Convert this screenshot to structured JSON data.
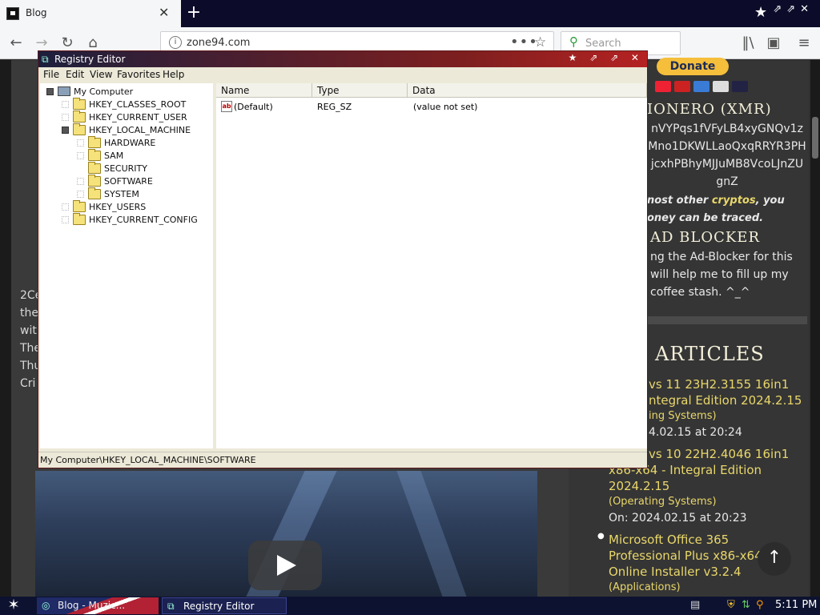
{
  "browser": {
    "tab_title": "Blog",
    "tab_close": "✕",
    "new_tab": "+",
    "url": "zone94.com",
    "search_placeholder": "Search",
    "window_controls": "⇗⇗✕"
  },
  "webpage": {
    "donate_label": "Donate",
    "monero_heading": "IONERO (XMR)",
    "monero_address_lines": [
      "nVYPqs1fVFyLB4xyGNQv1z",
      "Mno1DKWLLaoQxqRRYR3PH",
      "jcxhPBhyMJJuMB8VcoLJnZU",
      "gnZ"
    ],
    "monero_note_1_a": "nost other ",
    "monero_note_1_link": "cryptos",
    "monero_note_1_b": ", you",
    "monero_note_2": "oney can be traced.",
    "adblock_heading": "AD BLOCKER",
    "adblock_lines": [
      "ng the Ad-Blocker for this",
      "will help me to fill up my",
      "coffee stash. ^_^"
    ],
    "articles_heading": "ARTICLES",
    "article1_title_lines": [
      "vs 11 23H2.3155 16in1",
      "ntegral Edition 2024.2.15"
    ],
    "article1_category": "ing Systems)",
    "article1_date": "4.02.15 at 20:24",
    "article2_title_lines": [
      "vs 10 22H2.4046 16in1",
      "x86-x64 - Integral Edition",
      "2024.2.15"
    ],
    "article2_category": "(Operating Systems)",
    "article2_date": "On: 2024.02.15 at 20:23",
    "article3_title_lines": [
      "Microsoft Office 365",
      "Professional Plus x86-x64 -",
      "Online Installer v3.2.4"
    ],
    "article3_category": "(Applications)",
    "left_text_lines": [
      "2Ce",
      "the",
      "wit",
      "The",
      "Thu",
      "Cri"
    ],
    "totop_label": "↑"
  },
  "regedit": {
    "title": "Registry Editor",
    "window_controls": "★ ⇗ ⇗ ✕",
    "menu": [
      "File",
      "Edit",
      "View",
      "Favorites",
      "Help"
    ],
    "tree": {
      "root": "My Computer",
      "hives": [
        "HKEY_CLASSES_ROOT",
        "HKEY_CURRENT_USER",
        "HKEY_LOCAL_MACHINE",
        "HKEY_USERS",
        "HKEY_CURRENT_CONFIG"
      ],
      "hklm_children": [
        "HARDWARE",
        "SAM",
        "SECURITY",
        "SOFTWARE",
        "SYSTEM"
      ]
    },
    "columns": [
      "Name",
      "Type",
      "Data"
    ],
    "values": [
      {
        "name": "(Default)",
        "type": "REG_SZ",
        "data": "(value not set)"
      }
    ],
    "status_path": "My Computer\\HKEY_LOCAL_MACHINE\\SOFTWARE"
  },
  "taskbar": {
    "start": "✶",
    "items": [
      "Blog - Muzic...",
      "Registry Editor"
    ],
    "clock": "5:11 PM"
  },
  "colors": {
    "title_gradient_end": "#b52222",
    "taskbar": "#0d1230",
    "link_yellow": "#e9d76b"
  }
}
